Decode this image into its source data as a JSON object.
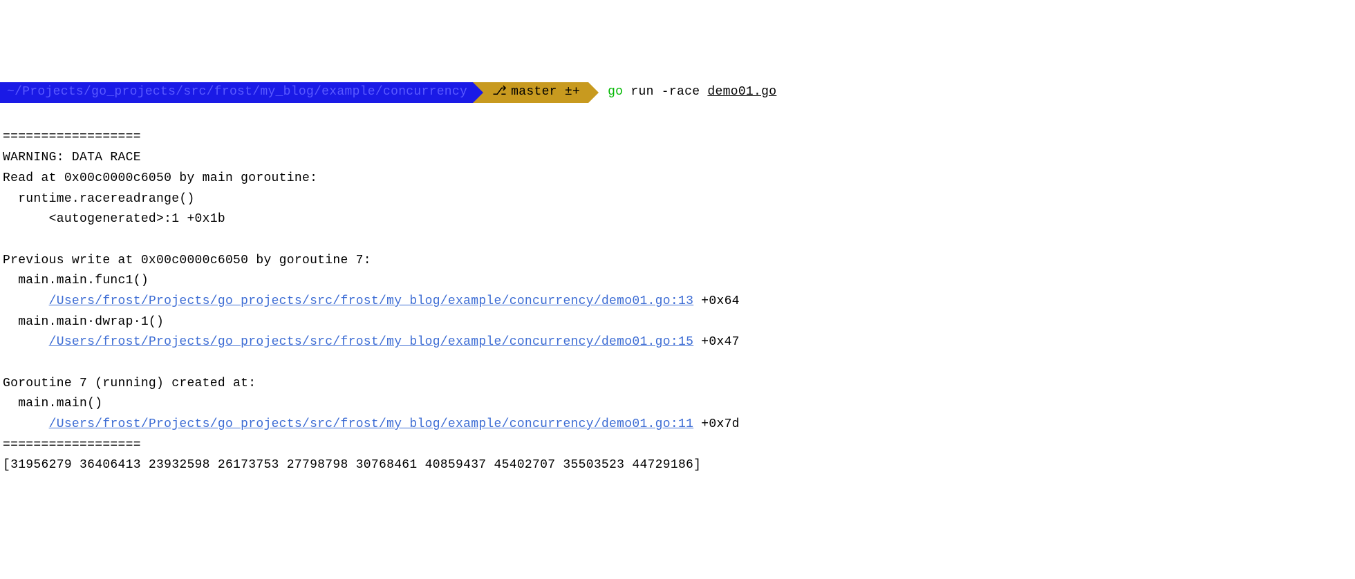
{
  "prompt": {
    "path": "~/Projects/go_projects/src/frost/my_blog/example/concurrency",
    "branch_icon": "⎇",
    "branch": "master ±+",
    "cmd_go": "go",
    "cmd_args": " run -race ",
    "cmd_file": "demo01.go"
  },
  "output": {
    "sep": "==================",
    "warn": "WARNING: DATA RACE",
    "read_at": "Read at 0x00c0000c6050 by main goroutine:",
    "read_fn": "  runtime.racereadrange()",
    "read_loc": "      <autogenerated>:1 +0x1b",
    "prev_write": "Previous write at 0x00c0000c6050 by goroutine 7:",
    "pw_fn1": "  main.main.func1()",
    "pw_link1": "/Users/frost/Projects/go_projects/src/frost/my_blog/example/concurrency/demo01.go:13",
    "pw_off1": " +0x64",
    "pw_fn2": "  main.main·dwrap·1()",
    "pw_link2": "/Users/frost/Projects/go_projects/src/frost/my_blog/example/concurrency/demo01.go:15",
    "pw_off2": " +0x47",
    "goroutine": "Goroutine 7 (running) created at:",
    "g_fn": "  main.main()",
    "g_link": "/Users/frost/Projects/go_projects/src/frost/my_blog/example/concurrency/demo01.go:11",
    "g_off": " +0x7d",
    "result": "[31956279 36406413 23932598 26173753 27798798 30768461 40859437 45402707 35503523 44729186]"
  }
}
